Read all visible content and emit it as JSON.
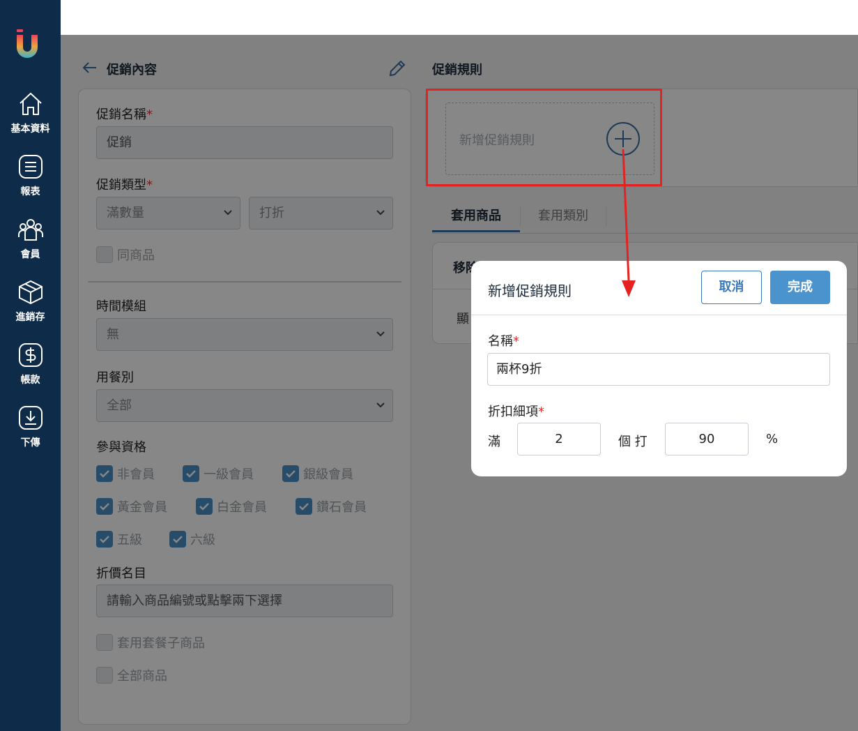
{
  "sidebar": {
    "items": [
      {
        "label": "基本資料",
        "icon": "home-icon"
      },
      {
        "label": "報表",
        "icon": "report-icon"
      },
      {
        "label": "會員",
        "icon": "members-icon"
      },
      {
        "label": "進銷存",
        "icon": "inventory-box-icon"
      },
      {
        "label": "帳款",
        "icon": "dollar-icon"
      },
      {
        "label": "下傳",
        "icon": "download-icon"
      }
    ]
  },
  "left_panel": {
    "title": "促銷內容",
    "name_label": "促銷名稱",
    "name_value": "促銷",
    "type_label": "促銷類型",
    "type_select1": "滿數量",
    "type_select2": "打折",
    "same_item_label": "同商品",
    "time_module_label": "時間模組",
    "time_module_value": "無",
    "dining_label": "用餐別",
    "dining_value": "全部",
    "eligibility_label": "參與資格",
    "eligibility": [
      "非會員",
      "一級會員",
      "銀級會員",
      "黃金會員",
      "白金會員",
      "鑽石會員",
      "五級",
      "六級"
    ],
    "discount_list_label": "折價名目",
    "discount_list_placeholder": "請輸入商品編號或點擊兩下選擇",
    "apply_combo_label": "套用套餐子商品",
    "all_items_label": "全部商品"
  },
  "right_panel": {
    "title": "促銷規則",
    "add_rule_text": "新增促銷規則",
    "tabs": [
      "套用商品",
      "套用類別"
    ],
    "table_header": "移除",
    "table_cell": "顯"
  },
  "modal": {
    "title": "新增促銷規則",
    "cancel_label": "取消",
    "done_label": "完成",
    "name_label": "名稱",
    "name_value": "兩杯9折",
    "detail_label": "折扣細項",
    "full_label": "滿",
    "qty_value": "2",
    "unit_label": "個 打",
    "percent_value": "90",
    "percent_sign": "%"
  },
  "colors": {
    "sidebar": "#0e2b4a",
    "accent": "#4b93cc",
    "highlight": "#e52222"
  }
}
